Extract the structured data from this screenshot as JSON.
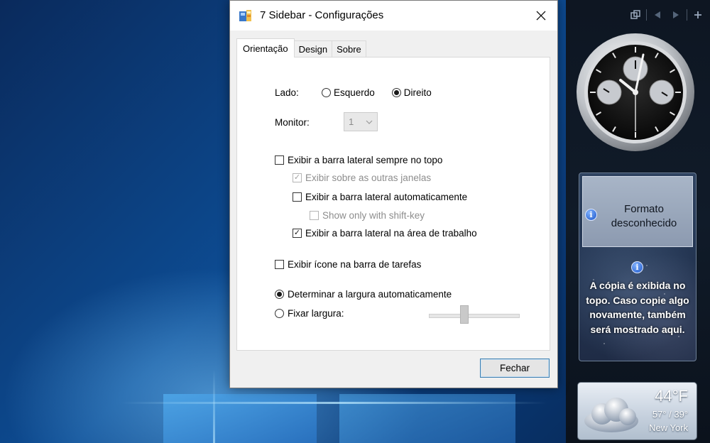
{
  "dialog": {
    "title": "7 Sidebar - Configurações",
    "tabs": [
      {
        "label": "Orientação",
        "active": true
      },
      {
        "label": "Design",
        "active": false
      },
      {
        "label": "Sobre",
        "active": false
      }
    ],
    "side": {
      "label": "Lado:",
      "options": [
        {
          "label": "Esquerdo",
          "checked": false
        },
        {
          "label": "Direito",
          "checked": true
        }
      ]
    },
    "monitor": {
      "label": "Monitor:",
      "value": "1",
      "enabled": false
    },
    "always_on_top": {
      "label": "Exibir a barra lateral sempre no topo",
      "checked": false
    },
    "over_windows": {
      "label": "Exibir sobre as outras janelas",
      "checked": true,
      "enabled": false
    },
    "auto_show": {
      "label": "Exibir a barra lateral automaticamente",
      "checked": false
    },
    "shift_key": {
      "label": "Show only with shift-key",
      "checked": false,
      "enabled": false
    },
    "on_desktop": {
      "label": "Exibir a barra lateral na área de trabalho",
      "checked": true
    },
    "taskbar_icon": {
      "label": "Exibir ícone na barra de tarefas",
      "checked": false
    },
    "width": {
      "auto_label": "Determinar a largura automaticamente",
      "auto_checked": true,
      "fixed_label": "Fixar largura:",
      "fixed_checked": false,
      "slider_enabled": false
    },
    "close_button": "Fechar"
  },
  "sidebar": {
    "toolbar_icons": [
      "restore-icon",
      "prev-icon",
      "next-icon",
      "add-icon"
    ],
    "slideshow": {
      "format_message": "Formato desconhecido",
      "copy_message": "A cópia é exibida no topo. Caso copie algo novamente, também será mostrado aqui."
    },
    "weather": {
      "temperature": "44°F",
      "range": "57° / 39°",
      "city": "New York"
    }
  },
  "colors": {
    "dialog_bg": "#f0f0f0",
    "sidebar_bg": "#0e1622",
    "desktop_bg": "#0d4c93",
    "button_border": "#3c7fb1"
  }
}
